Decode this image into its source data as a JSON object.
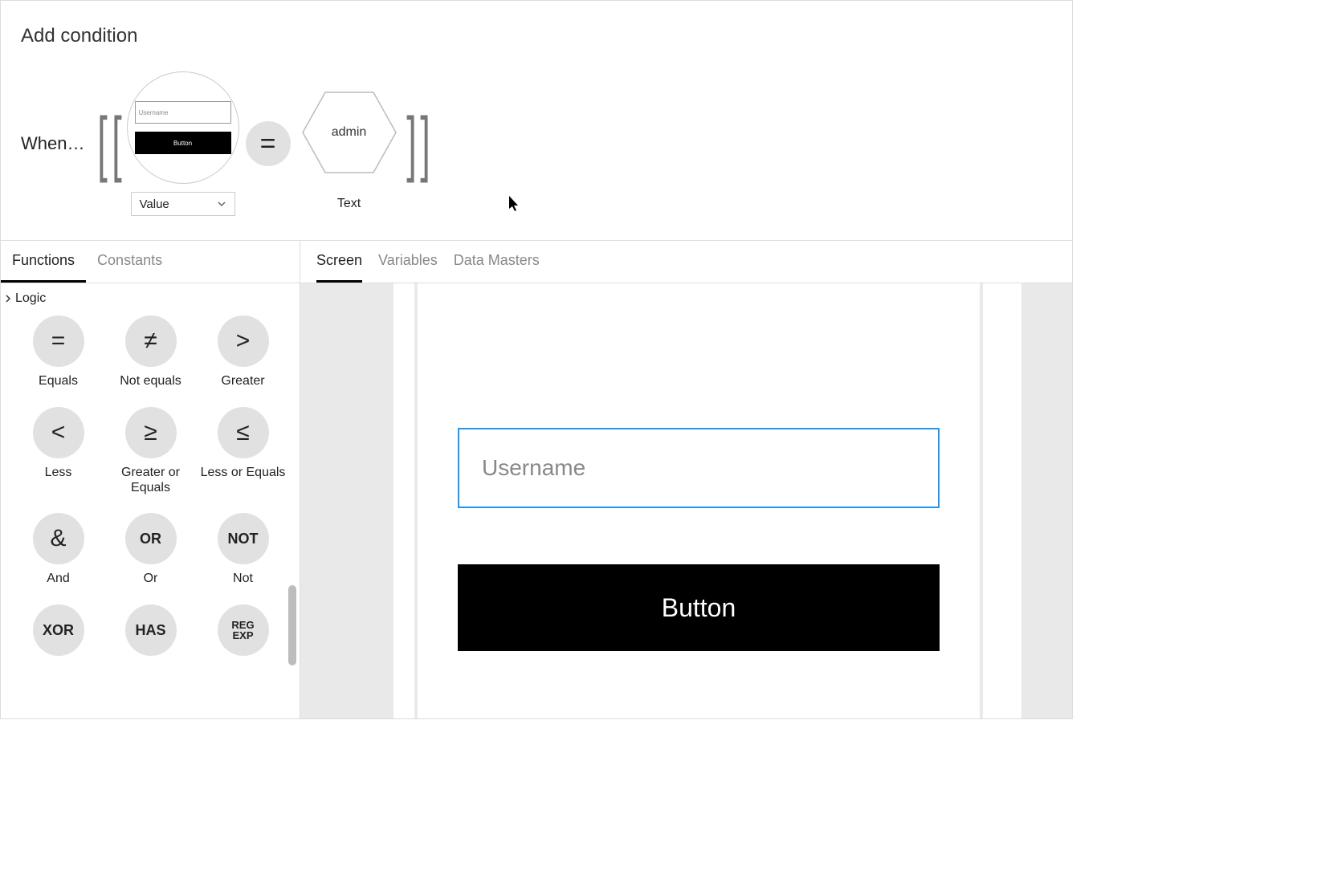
{
  "title": "Add condition",
  "expression": {
    "when_label": "When…",
    "left": {
      "thumb_input_placeholder": "Username",
      "thumb_button_label": "Button",
      "dropdown_value": "Value"
    },
    "operator": "=",
    "right": {
      "value": "admin",
      "type_label": "Text"
    }
  },
  "left_tabs": {
    "functions": "Functions",
    "constants": "Constants"
  },
  "logic_group_label": "Logic",
  "logic_items": [
    {
      "id": "equals",
      "symbol": "=",
      "kind": "sym",
      "label": "Equals"
    },
    {
      "id": "not-equals",
      "symbol": "≠",
      "kind": "sym",
      "label": "Not equals"
    },
    {
      "id": "greater",
      "symbol": ">",
      "kind": "sym",
      "label": "Greater"
    },
    {
      "id": "less",
      "symbol": "<",
      "kind": "sym",
      "label": "Less"
    },
    {
      "id": "gte",
      "symbol": "≥",
      "kind": "sym",
      "label": "Greater or Equals"
    },
    {
      "id": "lte",
      "symbol": "≤",
      "kind": "sym",
      "label": "Less or Equals"
    },
    {
      "id": "and",
      "symbol": "&",
      "kind": "sym",
      "label": "And"
    },
    {
      "id": "or",
      "symbol": "OR",
      "kind": "txt",
      "label": "Or"
    },
    {
      "id": "not",
      "symbol": "NOT",
      "kind": "txt",
      "label": "Not"
    },
    {
      "id": "xor",
      "symbol": "XOR",
      "kind": "txt",
      "label": ""
    },
    {
      "id": "has",
      "symbol": "HAS",
      "kind": "txt",
      "label": ""
    },
    {
      "id": "regexp",
      "symbol": "REG\nEXP",
      "kind": "txt-sm",
      "label": ""
    }
  ],
  "right_tabs": {
    "screen": "Screen",
    "variables": "Variables",
    "data_masters": "Data Masters"
  },
  "canvas": {
    "input_placeholder": "Username",
    "button_label": "Button"
  }
}
